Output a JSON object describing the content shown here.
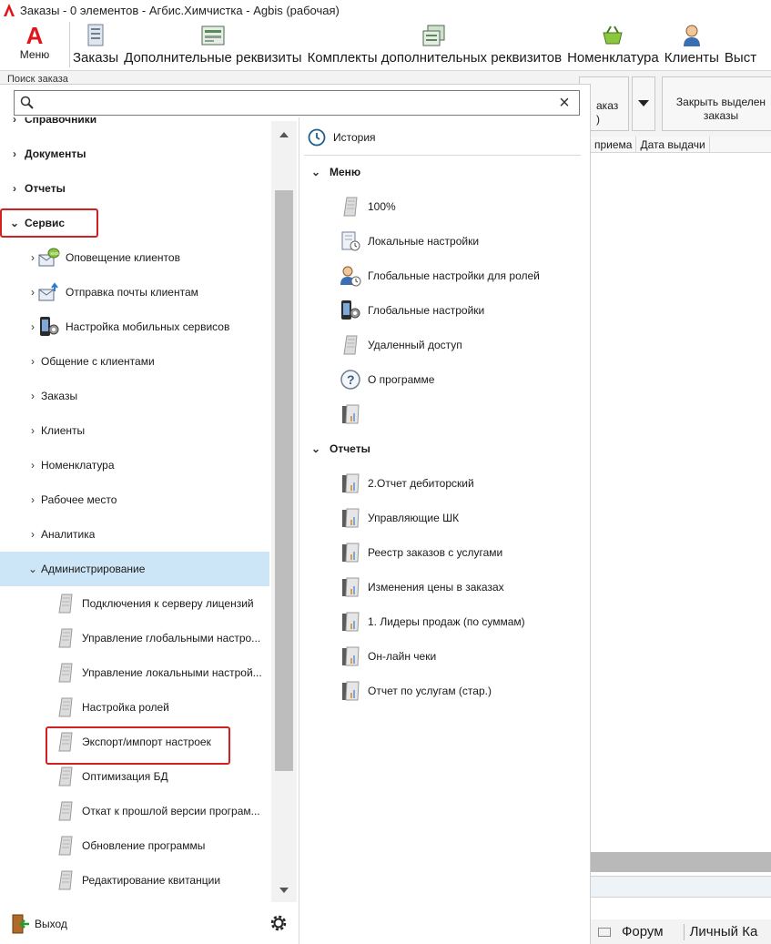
{
  "window": {
    "title": "Заказы - 0 элементов - Агбис.Химчистка - Agbis (рабочая)"
  },
  "ribbon": {
    "menu_label": "Меню",
    "menu_logo_letter": "A",
    "items": [
      {
        "label": "Заказы",
        "icon": "orders-icon"
      },
      {
        "label": "Дополнительные реквизиты",
        "icon": "form-icon"
      },
      {
        "label": "Комплекты дополнительных реквизитов",
        "icon": "bundle-icon"
      },
      {
        "label": "Номенклатура",
        "icon": "basket-icon"
      },
      {
        "label": "Клиенты",
        "icon": "user-icon"
      },
      {
        "label": "Выст",
        "icon": ""
      }
    ]
  },
  "toolbar": {
    "search_order_label": "Поиск заказа",
    "partial_button_label": "аказ\n)",
    "close_selected_label": "Закрыть выделен\nзаказы"
  },
  "grid": {
    "columns": [
      "приема",
      "Дата выдачи"
    ]
  },
  "statusbar": {
    "forum": "Форум",
    "personal": "Личный Ка"
  },
  "overlay": {
    "search": {
      "placeholder": "",
      "value": ""
    },
    "tree": [
      {
        "label": "Справочники",
        "level": 0,
        "bold": true,
        "expanded": false
      },
      {
        "label": "Документы",
        "level": 0,
        "bold": true,
        "expanded": false
      },
      {
        "label": "Отчеты",
        "level": 0,
        "bold": true,
        "expanded": false
      },
      {
        "label": "Сервис",
        "level": 0,
        "bold": true,
        "expanded": true,
        "highlighted": true
      },
      {
        "label": "Оповещение клиентов",
        "level": 1,
        "icon": "sms-mail-icon",
        "expanded": false
      },
      {
        "label": "Отправка почты клиентам",
        "level": 1,
        "icon": "mail-send-icon",
        "expanded": false
      },
      {
        "label": "Настройка мобильных сервисов",
        "level": 1,
        "icon": "mobile-settings-icon",
        "expanded": false
      },
      {
        "label": "Общение с клиентами",
        "level": 1,
        "expanded": false
      },
      {
        "label": "Заказы",
        "level": 1,
        "expanded": false
      },
      {
        "label": "Клиенты",
        "level": 1,
        "expanded": false
      },
      {
        "label": "Номенклатура",
        "level": 1,
        "expanded": false
      },
      {
        "label": "Рабочее место",
        "level": 1,
        "expanded": false
      },
      {
        "label": "Аналитика",
        "level": 1,
        "expanded": false
      },
      {
        "label": "Администрирование",
        "level": 1,
        "expanded": true,
        "selected": true
      },
      {
        "label": "Подключения к серверу лицензий",
        "level": 2,
        "icon": "document-icon"
      },
      {
        "label": "Управление глобальными настро...",
        "level": 2,
        "icon": "document-icon"
      },
      {
        "label": "Управление локальными настрой...",
        "level": 2,
        "icon": "document-icon"
      },
      {
        "label": "Настройка ролей",
        "level": 2,
        "icon": "document-icon"
      },
      {
        "label": "Экспорт/импорт настроек",
        "level": 2,
        "icon": "document-icon",
        "highlighted": true
      },
      {
        "label": "Оптимизация БД",
        "level": 2,
        "icon": "document-icon"
      },
      {
        "label": "Откат к прошлой версии програм...",
        "level": 2,
        "icon": "document-icon"
      },
      {
        "label": "Обновление программы",
        "level": 2,
        "icon": "document-icon"
      },
      {
        "label": "Редактирование квитанции",
        "level": 2,
        "icon": "document-icon"
      }
    ],
    "history_label": "История",
    "menu_sections": [
      {
        "title": "Меню",
        "items": [
          {
            "label": "100%",
            "icon": "document-icon"
          },
          {
            "label": "Локальные настройки",
            "icon": "local-settings-icon"
          },
          {
            "label": "Глобальные настройки для ролей",
            "icon": "role-settings-icon"
          },
          {
            "label": "Глобальные настройки",
            "icon": "global-settings-icon"
          },
          {
            "label": "Удаленный доступ",
            "icon": "document-icon"
          },
          {
            "label": "О программе",
            "icon": "help-icon"
          },
          {
            "label": "",
            "icon": "report-icon"
          }
        ]
      },
      {
        "title": "Отчеты",
        "items": [
          {
            "label": "2.Отчет дебиторский",
            "icon": "report-icon"
          },
          {
            "label": "Управляющие ШК",
            "icon": "report-icon"
          },
          {
            "label": "Реестр заказов с услугами",
            "icon": "report-icon"
          },
          {
            "label": "Изменения цены в заказах",
            "icon": "report-icon"
          },
          {
            "label": "1. Лидеры продаж (по суммам)",
            "icon": "report-icon"
          },
          {
            "label": "Он-лайн чеки",
            "icon": "report-icon"
          },
          {
            "label": "Отчет по услугам (стар.)",
            "icon": "report-icon"
          }
        ]
      }
    ],
    "exit_label": "Выход"
  },
  "colors": {
    "brand_red": "#e0151b",
    "highlight_border": "#d02020",
    "selected_row": "#cde6f7"
  }
}
